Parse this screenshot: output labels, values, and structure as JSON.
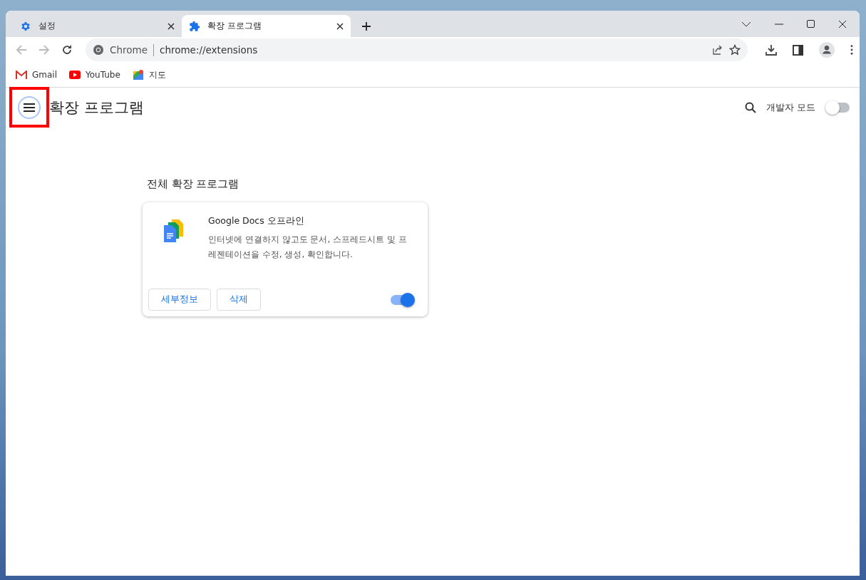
{
  "tabs": [
    {
      "kind": "gear",
      "title": "설정",
      "selected": false
    },
    {
      "kind": "puzzle",
      "title": "확장 프로그램",
      "selected": true
    }
  ],
  "omnibox": {
    "site_label": "Chrome",
    "url": "chrome://extensions"
  },
  "bookmarks": [
    {
      "kind": "gmail",
      "label": "Gmail"
    },
    {
      "kind": "youtube",
      "label": "YouTube"
    },
    {
      "kind": "maps",
      "label": "지도"
    }
  ],
  "page": {
    "title": "확장 프로그램",
    "dev_mode": {
      "label": "개발자 모드",
      "on": false
    }
  },
  "section_title": "전체 확장 프로그램",
  "extensions": [
    {
      "name": "Google Docs 오프라인",
      "description": "인터넷에 연결하지 않고도 문서, 스프레드시트 및 프레젠테이션을 수정, 생성, 확인합니다.",
      "buttons": [
        "세부정보",
        "삭제"
      ],
      "enabled": true
    }
  ]
}
